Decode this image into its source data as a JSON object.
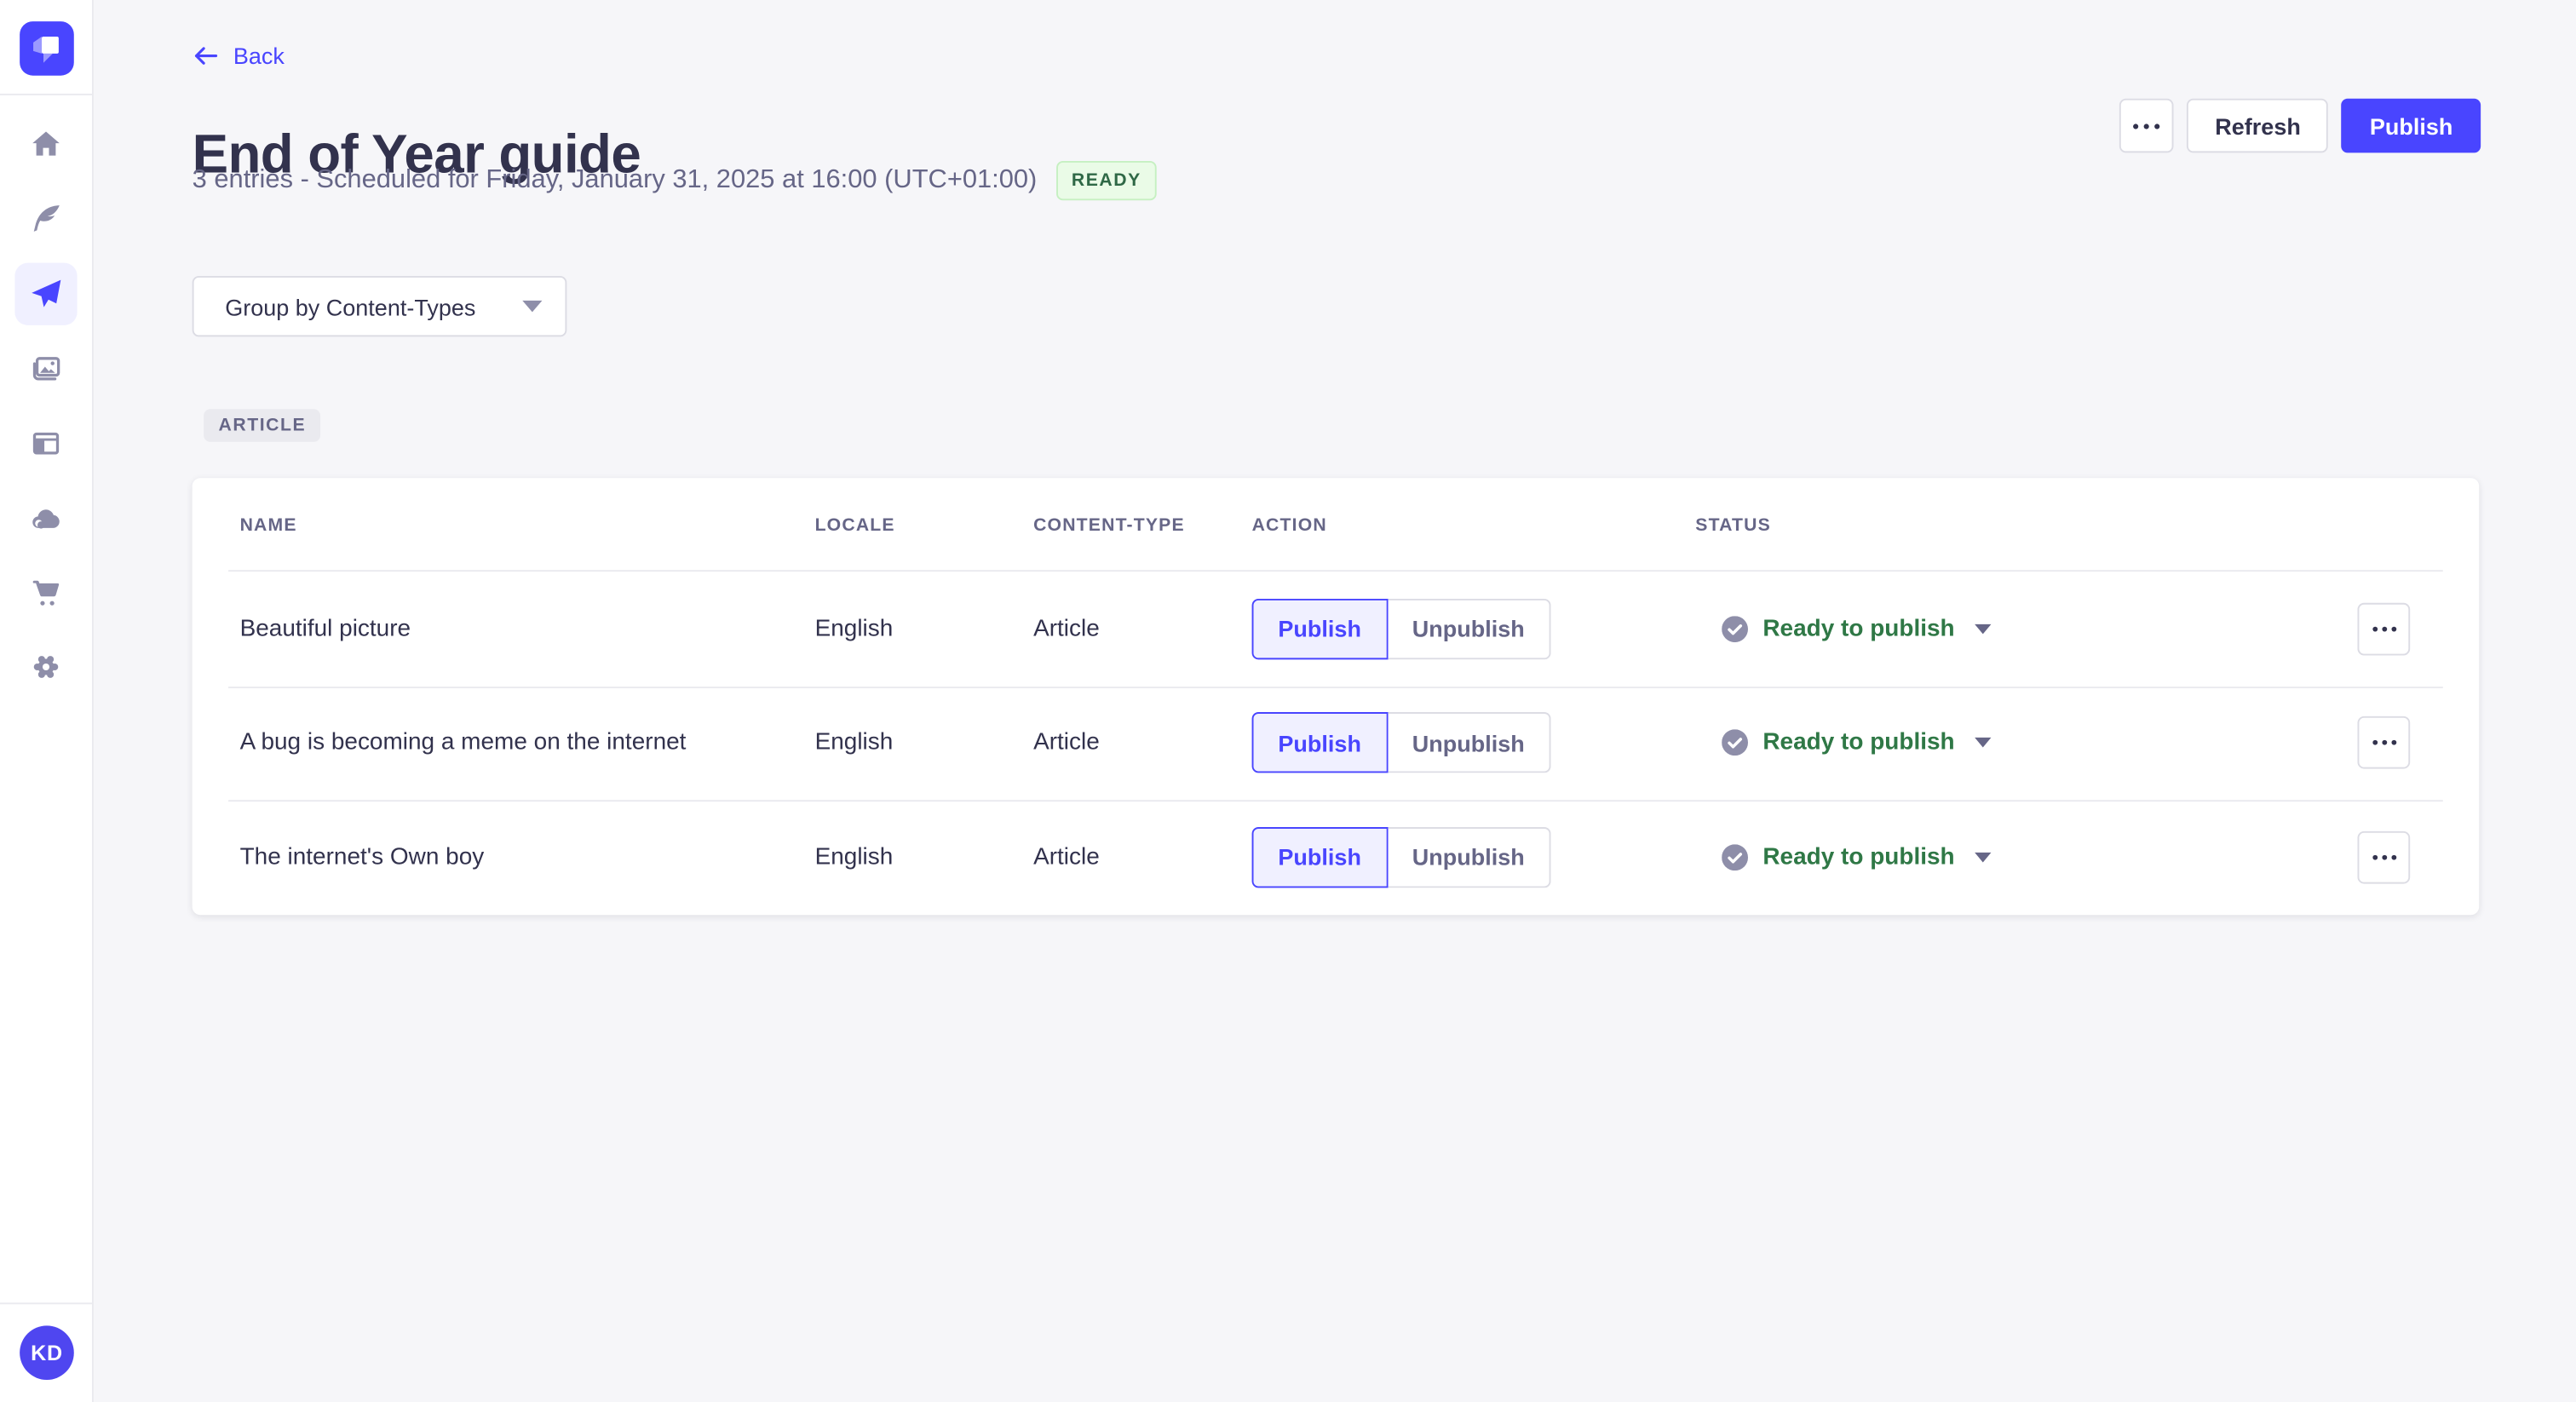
{
  "sidebar": {
    "logo_icon": "strapi-logo",
    "items": [
      {
        "name": "home",
        "icon": "home-icon",
        "active": false
      },
      {
        "name": "content-manager",
        "icon": "feather-icon",
        "active": false
      },
      {
        "name": "releases",
        "icon": "paper-plane-icon",
        "active": true
      },
      {
        "name": "media-library",
        "icon": "pictures-icon",
        "active": false
      },
      {
        "name": "content-type-builder",
        "icon": "layout-icon",
        "active": false
      },
      {
        "name": "cloud",
        "icon": "cloud-icon",
        "active": false
      },
      {
        "name": "marketplace",
        "icon": "cart-icon",
        "active": false
      },
      {
        "name": "settings",
        "icon": "gear-icon",
        "active": false
      }
    ],
    "avatar_initials": "KD"
  },
  "header": {
    "back_label": "Back",
    "title": "End of Year guide",
    "subtitle": "3 entries - Scheduled for Friday, January 31, 2025 at 16:00 (UTC+01:00)",
    "status_badge": "READY",
    "more_icon": "ellipsis-icon",
    "refresh_label": "Refresh",
    "publish_label": "Publish"
  },
  "toolbar": {
    "group_by_label": "Group by Content-Types",
    "caret_icon": "chevron-down-icon"
  },
  "content": {
    "group_heading": "ARTICLE",
    "table": {
      "columns": [
        "NAME",
        "LOCALE",
        "CONTENT-TYPE",
        "ACTION",
        "STATUS"
      ],
      "actions": {
        "publish": "Publish",
        "unpublish": "Unpublish"
      },
      "rows": [
        {
          "name": "Beautiful picture",
          "locale": "English",
          "content_type": "Article",
          "status": "Ready to publish"
        },
        {
          "name": "A bug is becoming a meme on the internet",
          "locale": "English",
          "content_type": "Article",
          "status": "Ready to publish"
        },
        {
          "name": "The internet's Own boy",
          "locale": "English",
          "content_type": "Article",
          "status": "Ready to publish"
        }
      ]
    }
  },
  "fab": {
    "icon": "question-mark-icon"
  },
  "colors": {
    "primary": "#4945ff",
    "primary_light": "#f0f0ff",
    "badge_text": "#2f6846",
    "badge_bg": "#eafbe7",
    "badge_border": "#c6f0c2",
    "status_green": "#2f7846",
    "text": "#32324d",
    "text_muted": "#666687",
    "icon_gray": "#8e8ea9",
    "border": "#dcdce4",
    "divider": "#eaeaef",
    "background": "#f6f6f9"
  }
}
